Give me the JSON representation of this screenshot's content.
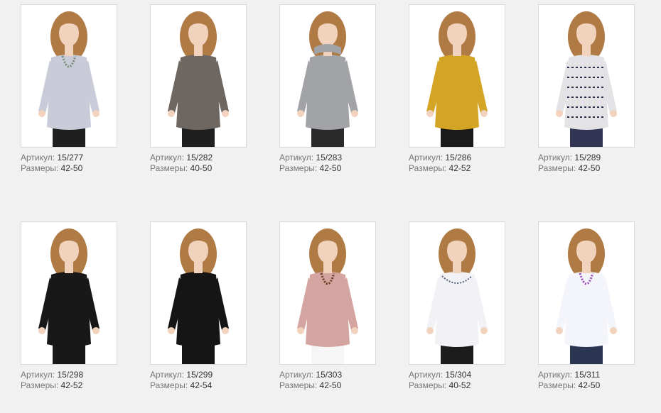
{
  "labels": {
    "article": "Артикул:",
    "sizes": "Размеры:"
  },
  "products": [
    {
      "article": "15/277",
      "sizes": "42-50",
      "top_color": "#c9ccd8",
      "bottom_color": "#1f1f1f",
      "accessory": "necklace-beads"
    },
    {
      "article": "15/282",
      "sizes": "40-50",
      "top_color": "#6e6660",
      "bottom_color": "#1f1f1f",
      "accessory": "none"
    },
    {
      "article": "15/283",
      "sizes": "42-50",
      "top_color": "#a2a3a6",
      "bottom_color": "#2a2a2a",
      "accessory": "hood"
    },
    {
      "article": "15/286",
      "sizes": "42-52",
      "top_color": "#d4a424",
      "bottom_color": "#1a1a1a",
      "accessory": "none"
    },
    {
      "article": "15/289",
      "sizes": "42-50",
      "top_color": "#e3e3e6",
      "bottom_color": "#313553",
      "accessory": "pattern"
    },
    {
      "article": "15/298",
      "sizes": "42-52",
      "top_color": "#181818",
      "bottom_color": "#181818",
      "accessory": "none"
    },
    {
      "article": "15/299",
      "sizes": "42-54",
      "top_color": "#151515",
      "bottom_color": "#151515",
      "accessory": "none"
    },
    {
      "article": "15/303",
      "sizes": "42-50",
      "top_color": "#d4a4a0",
      "bottom_color": "#f6f6f6",
      "accessory": "necklace-brown"
    },
    {
      "article": "15/304",
      "sizes": "40-52",
      "top_color": "#f2f2f6",
      "bottom_color": "#1c1c1c",
      "accessory": "embroidery"
    },
    {
      "article": "15/311",
      "sizes": "42-50",
      "top_color": "#f4f5fb",
      "bottom_color": "#2a3552",
      "accessory": "necklace-purple"
    }
  ]
}
